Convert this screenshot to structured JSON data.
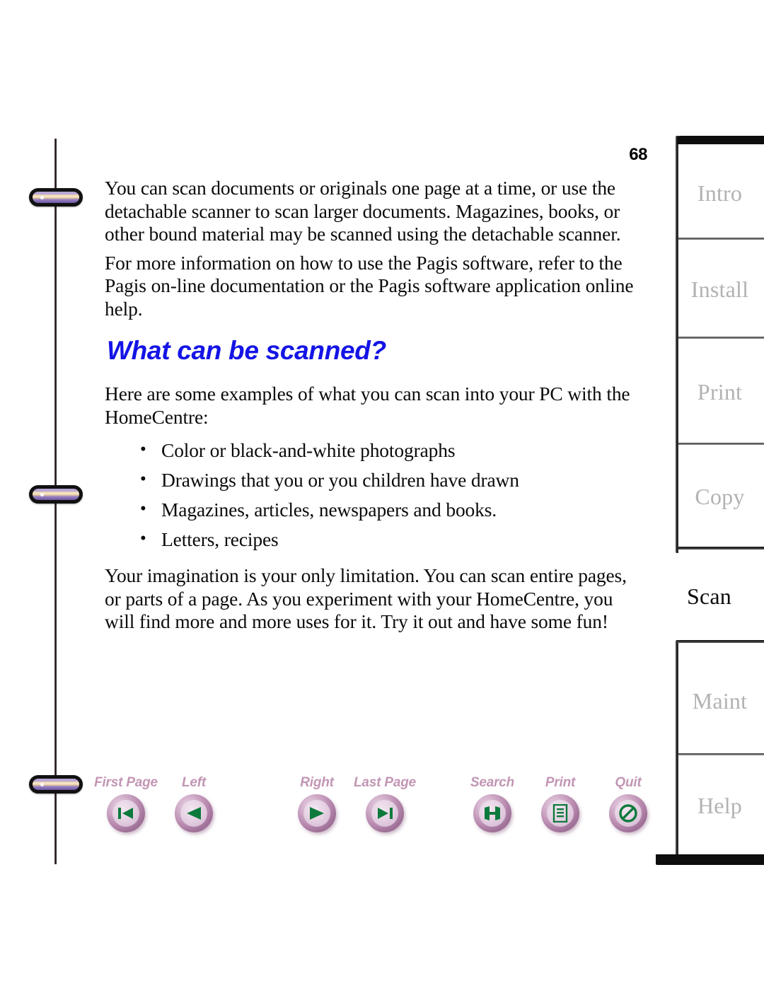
{
  "page": {
    "number": "68"
  },
  "content": {
    "paragraphs": [
      "You can scan documents or originals one page at a time, or use the detachable scanner to scan larger documents. Magazines, books, or other bound material may be scanned using the detachable scanner.",
      "For more information on how to use the Pagis software, refer to the Pagis on-line documentation or the Pagis software application online help."
    ],
    "heading": "What can be scanned?",
    "intro": "Here are some examples of what you can scan into your PC with the HomeCentre:",
    "bullets": [
      "Color or black-and-white photographs",
      "Drawings that you or you children have drawn",
      "Magazines, articles, newspapers and books.",
      "Letters, recipes"
    ],
    "closing": "Your imagination is your only limitation. You can scan entire pages, or parts of a page. As you experiment with your HomeCentre, you will find more and more uses for it. Try it out and have some fun!"
  },
  "nav": {
    "pages": [
      {
        "label": "First Page",
        "icon": "first-page-icon"
      },
      {
        "label": "Left",
        "icon": "previous-page-icon"
      },
      {
        "label": "Right",
        "icon": "next-page-icon"
      },
      {
        "label": "Last Page",
        "icon": "last-page-icon"
      }
    ],
    "tools": [
      {
        "label": "Search",
        "icon": "search-icon"
      },
      {
        "label": "Print",
        "icon": "print-icon"
      },
      {
        "label": "Quit",
        "icon": "quit-icon"
      }
    ]
  },
  "tabs": {
    "upper": [
      "Intro",
      "Install",
      "Print",
      "Copy"
    ],
    "active": "Scan",
    "lower": [
      "Maint",
      "Help"
    ]
  },
  "colors": {
    "heading": "#1414E6",
    "nav_label": "#C296B4",
    "glyph": "#0C7A3C",
    "tab_inactive": "#B2B2B2",
    "tab_active": "#0B0B0B"
  }
}
